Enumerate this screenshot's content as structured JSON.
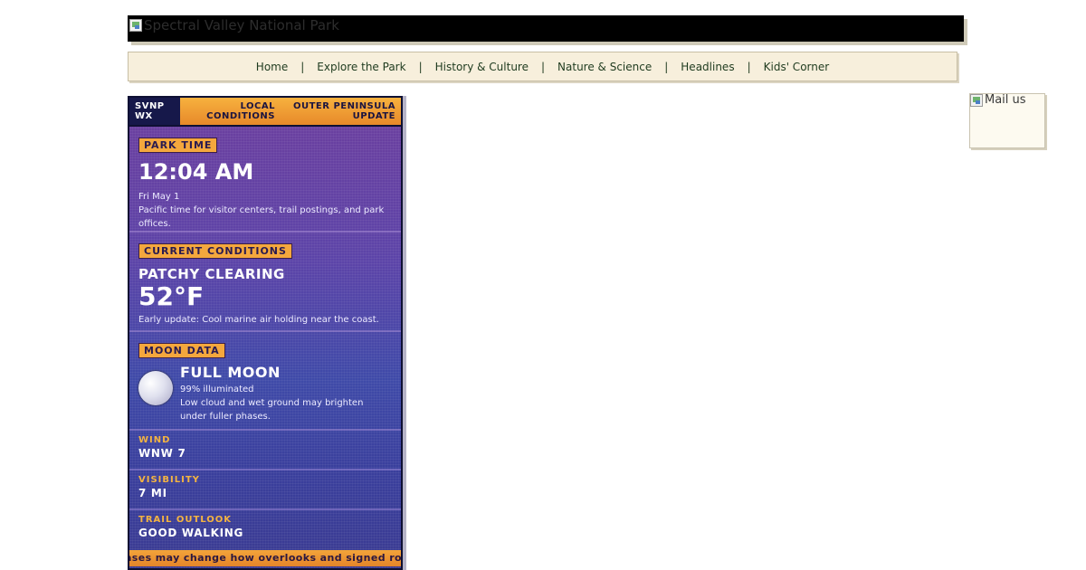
{
  "banner": {
    "image_alt": "Spectral Valley National Park"
  },
  "nav": {
    "items": [
      "Home",
      "Explore the Park",
      "History & Culture",
      "Nature & Science",
      "Headlines",
      "Kids' Corner"
    ],
    "separator": "|"
  },
  "widget": {
    "brand_line1": "SVNP",
    "brand_line2": "WX",
    "tabs": [
      {
        "line1": "LOCAL",
        "line2": "CONDITIONS"
      },
      {
        "line1": "OUTER PENINSULA",
        "line2": "UPDATE"
      }
    ],
    "park_time": {
      "label": "PARK TIME",
      "time": "12:04 AM",
      "date": "Fri May 1",
      "note": "Pacific time for visitor centers, trail postings, and park offices."
    },
    "current_conditions": {
      "label": "CURRENT CONDITIONS",
      "summary": "PATCHY CLEARING",
      "temperature": "52°F",
      "note": "Early update: Cool marine air holding near the coast."
    },
    "moon": {
      "label": "MOON DATA",
      "phase": "FULL MOON",
      "illumination": "99% illuminated",
      "note": "Low cloud and wet ground may brighten under fuller phases."
    },
    "stats": [
      {
        "label": "WIND",
        "value": "WNW 7"
      },
      {
        "label": "VISIBILITY",
        "value": "7 MI"
      },
      {
        "label": "TRAIL OUTLOOK",
        "value": "GOOD WALKING"
      }
    ],
    "ticker": "n phases may change how overlooks and signed ro"
  },
  "mail": {
    "image_alt": "Mail us"
  },
  "colors": {
    "accent_orange": "#f4a73d",
    "widget_purple": "#5c44a8",
    "nav_bg": "#f7efdc",
    "label_gold": "#f4b441"
  }
}
